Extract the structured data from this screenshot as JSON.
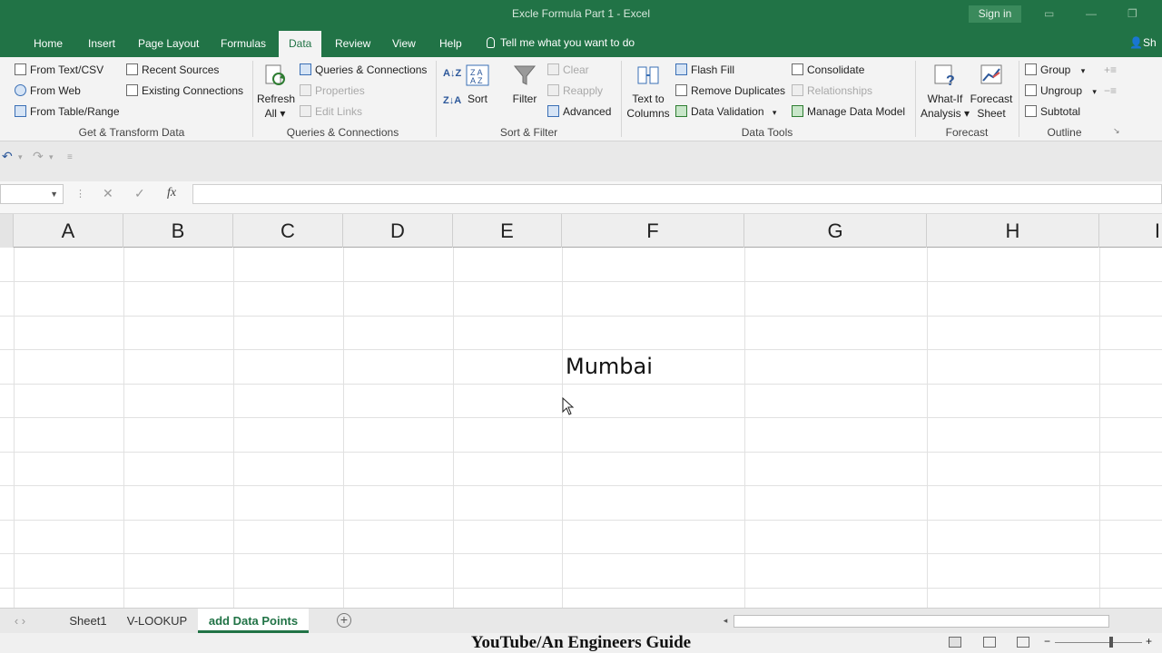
{
  "window": {
    "title": "Excle Formula Part 1  -  Excel",
    "sign_in": "Sign in"
  },
  "tabs": [
    {
      "label": "Home"
    },
    {
      "label": "Insert"
    },
    {
      "label": "Page Layout"
    },
    {
      "label": "Formulas"
    },
    {
      "label": "Data"
    },
    {
      "label": "Review"
    },
    {
      "label": "View"
    },
    {
      "label": "Help"
    }
  ],
  "active_tab": "Data",
  "tell_me": "Tell me what you want to do",
  "share_label": "Sh",
  "ribbon": {
    "get_transform": {
      "label": "Get & Transform Data",
      "from_text": "From Text/CSV",
      "from_web": "From Web",
      "from_table": "From Table/Range",
      "recent_sources": "Recent Sources",
      "existing_connections": "Existing Connections"
    },
    "queries": {
      "label": "Queries & Connections",
      "refresh": "Refresh",
      "refresh_all": "All",
      "queries_connections": "Queries & Connections",
      "properties": "Properties",
      "edit_links": "Edit Links"
    },
    "sort_filter": {
      "label": "Sort & Filter",
      "sort": "Sort",
      "filter": "Filter",
      "clear": "Clear",
      "reapply": "Reapply",
      "advanced": "Advanced"
    },
    "data_tools": {
      "label": "Data Tools",
      "text_to": "Text to",
      "columns": "Columns",
      "flash_fill": "Flash Fill",
      "remove_duplicates": "Remove Duplicates",
      "data_validation": "Data Validation",
      "consolidate": "Consolidate",
      "relationships": "Relationships",
      "manage_data_model": "Manage Data Model"
    },
    "forecast": {
      "label": "Forecast",
      "what_if": "What-If",
      "analysis": "Analysis",
      "forecast_sheet_1": "Forecast",
      "forecast_sheet_2": "Sheet"
    },
    "outline": {
      "label": "Outline",
      "group": "Group",
      "ungroup": "Ungroup",
      "subtotal": "Subtotal"
    }
  },
  "columns": [
    "A",
    "B",
    "C",
    "D",
    "E",
    "F",
    "G",
    "H",
    "I"
  ],
  "cell_value": "Mumbai",
  "sheets": [
    {
      "label": "Sheet1"
    },
    {
      "label": "V-LOOKUP"
    },
    {
      "label": "add Data Points"
    }
  ],
  "active_sheet": "add Data Points",
  "watermark": "YouTube/An Engineers Guide",
  "colors": {
    "excel_green": "#217346",
    "ribbon_bg": "#f3f3f3"
  }
}
